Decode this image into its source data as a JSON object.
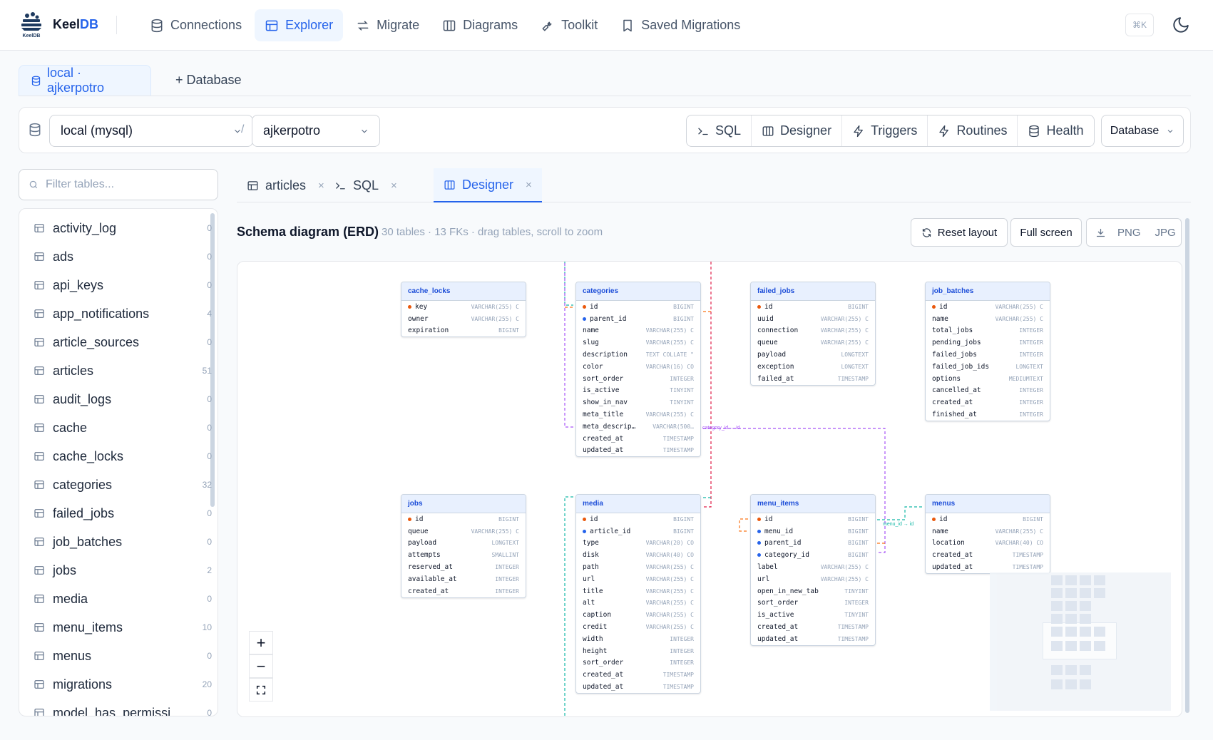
{
  "app": {
    "brand_prefix": "Keel",
    "brand_suffix": "DB",
    "logo_text": "KeelDB",
    "shortcut": "⌘K"
  },
  "nav": [
    {
      "label": "Connections",
      "icon": "database-icon"
    },
    {
      "label": "Explorer",
      "icon": "table-icon",
      "active": true
    },
    {
      "label": "Migrate",
      "icon": "arrows-icon"
    },
    {
      "label": "Diagrams",
      "icon": "columns-icon"
    },
    {
      "label": "Toolkit",
      "icon": "wrench-icon"
    },
    {
      "label": "Saved Migrations",
      "icon": "bookmark-icon"
    }
  ],
  "connection_tabs": {
    "active": "local · ajkerpotro",
    "add": "+ Database"
  },
  "toolbar": {
    "connection": "local (mysql)",
    "separator": "/",
    "schema": "ajkerpotro",
    "buttons": [
      "SQL",
      "Designer",
      "Triggers",
      "Routines",
      "Health"
    ],
    "database_menu": "Database"
  },
  "sidebar": {
    "filter_placeholder": "Filter tables...",
    "tables": [
      {
        "name": "activity_log",
        "count": "0"
      },
      {
        "name": "ads",
        "count": "0"
      },
      {
        "name": "api_keys",
        "count": "0"
      },
      {
        "name": "app_notifications",
        "count": "4"
      },
      {
        "name": "article_sources",
        "count": "0"
      },
      {
        "name": "articles",
        "count": "51"
      },
      {
        "name": "audit_logs",
        "count": "0"
      },
      {
        "name": "cache",
        "count": "0"
      },
      {
        "name": "cache_locks",
        "count": "0"
      },
      {
        "name": "categories",
        "count": "32"
      },
      {
        "name": "failed_jobs",
        "count": "0"
      },
      {
        "name": "job_batches",
        "count": "0"
      },
      {
        "name": "jobs",
        "count": "2"
      },
      {
        "name": "media",
        "count": "0"
      },
      {
        "name": "menu_items",
        "count": "10"
      },
      {
        "name": "menus",
        "count": "0"
      },
      {
        "name": "migrations",
        "count": "20"
      },
      {
        "name": "model_has_permissi",
        "count": "0"
      }
    ]
  },
  "editor_tabs": [
    {
      "label": "articles",
      "close": "×"
    },
    {
      "label": "SQL",
      "close": "×"
    },
    {
      "label": "Designer",
      "close": "×",
      "active": true
    }
  ],
  "erd": {
    "title": "Schema diagram (ERD)",
    "subtitle": "30 tables · 13 FKs · drag tables, scroll to zoom",
    "reset_layout": "Reset layout",
    "full_screen": "Full screen",
    "png": "PNG",
    "jpg": "JPG",
    "zoom_in": "+",
    "zoom_out": "−",
    "link_labels": [
      "category_id → id",
      "menu_id → id"
    ],
    "colors": {
      "pk": "#ea580c",
      "fk": "#2563eb",
      "accent": "#2563eb"
    },
    "tables": [
      {
        "name": "cache_locks",
        "columns": [
          {
            "name": "key",
            "type": "VARCHAR(255) C",
            "kind": "pk"
          },
          {
            "name": "owner",
            "type": "VARCHAR(255) C"
          },
          {
            "name": "expiration",
            "type": "BIGINT"
          }
        ]
      },
      {
        "name": "categories",
        "columns": [
          {
            "name": "id",
            "type": "BIGINT",
            "kind": "pk"
          },
          {
            "name": "parent_id",
            "type": "BIGINT",
            "kind": "fk"
          },
          {
            "name": "name",
            "type": "VARCHAR(255) C"
          },
          {
            "name": "slug",
            "type": "VARCHAR(255) C"
          },
          {
            "name": "description",
            "type": "TEXT COLLATE \""
          },
          {
            "name": "color",
            "type": "VARCHAR(16) CO"
          },
          {
            "name": "sort_order",
            "type": "INTEGER"
          },
          {
            "name": "is_active",
            "type": "TINYINT"
          },
          {
            "name": "show_in_nav",
            "type": "TINYINT"
          },
          {
            "name": "meta_title",
            "type": "VARCHAR(255) C"
          },
          {
            "name": "meta_descrip…",
            "type": "VARCHAR(500…"
          },
          {
            "name": "created_at",
            "type": "TIMESTAMP"
          },
          {
            "name": "updated_at",
            "type": "TIMESTAMP"
          }
        ]
      },
      {
        "name": "failed_jobs",
        "columns": [
          {
            "name": "id",
            "type": "BIGINT",
            "kind": "pk"
          },
          {
            "name": "uuid",
            "type": "VARCHAR(255) C"
          },
          {
            "name": "connection",
            "type": "VARCHAR(255) C"
          },
          {
            "name": "queue",
            "type": "VARCHAR(255) C"
          },
          {
            "name": "payload",
            "type": "LONGTEXT"
          },
          {
            "name": "exception",
            "type": "LONGTEXT"
          },
          {
            "name": "failed_at",
            "type": "TIMESTAMP"
          }
        ]
      },
      {
        "name": "job_batches",
        "columns": [
          {
            "name": "id",
            "type": "VARCHAR(255) C",
            "kind": "pk"
          },
          {
            "name": "name",
            "type": "VARCHAR(255) C"
          },
          {
            "name": "total_jobs",
            "type": "INTEGER"
          },
          {
            "name": "pending_jobs",
            "type": "INTEGER"
          },
          {
            "name": "failed_jobs",
            "type": "INTEGER"
          },
          {
            "name": "failed_job_ids",
            "type": "LONGTEXT"
          },
          {
            "name": "options",
            "type": "MEDIUMTEXT"
          },
          {
            "name": "cancelled_at",
            "type": "INTEGER"
          },
          {
            "name": "created_at",
            "type": "INTEGER"
          },
          {
            "name": "finished_at",
            "type": "INTEGER"
          }
        ]
      },
      {
        "name": "jobs",
        "columns": [
          {
            "name": "id",
            "type": "BIGINT",
            "kind": "pk"
          },
          {
            "name": "queue",
            "type": "VARCHAR(255) C"
          },
          {
            "name": "payload",
            "type": "LONGTEXT"
          },
          {
            "name": "attempts",
            "type": "SMALLINT"
          },
          {
            "name": "reserved_at",
            "type": "INTEGER"
          },
          {
            "name": "available_at",
            "type": "INTEGER"
          },
          {
            "name": "created_at",
            "type": "INTEGER"
          }
        ]
      },
      {
        "name": "media",
        "columns": [
          {
            "name": "id",
            "type": "BIGINT",
            "kind": "pk"
          },
          {
            "name": "article_id",
            "type": "BIGINT",
            "kind": "fk"
          },
          {
            "name": "type",
            "type": "VARCHAR(20) CO"
          },
          {
            "name": "disk",
            "type": "VARCHAR(40) CO"
          },
          {
            "name": "path",
            "type": "VARCHAR(255) C"
          },
          {
            "name": "url",
            "type": "VARCHAR(255) C"
          },
          {
            "name": "title",
            "type": "VARCHAR(255) C"
          },
          {
            "name": "alt",
            "type": "VARCHAR(255) C"
          },
          {
            "name": "caption",
            "type": "VARCHAR(255) C"
          },
          {
            "name": "credit",
            "type": "VARCHAR(255) C"
          },
          {
            "name": "width",
            "type": "INTEGER"
          },
          {
            "name": "height",
            "type": "INTEGER"
          },
          {
            "name": "sort_order",
            "type": "INTEGER"
          },
          {
            "name": "created_at",
            "type": "TIMESTAMP"
          },
          {
            "name": "updated_at",
            "type": "TIMESTAMP"
          }
        ]
      },
      {
        "name": "menu_items",
        "columns": [
          {
            "name": "id",
            "type": "BIGINT",
            "kind": "pk"
          },
          {
            "name": "menu_id",
            "type": "BIGINT",
            "kind": "fk"
          },
          {
            "name": "parent_id",
            "type": "BIGINT",
            "kind": "fk"
          },
          {
            "name": "category_id",
            "type": "BIGINT",
            "kind": "fk"
          },
          {
            "name": "label",
            "type": "VARCHAR(255) C"
          },
          {
            "name": "url",
            "type": "VARCHAR(255) C"
          },
          {
            "name": "open_in_new_tab",
            "type": "TINYINT"
          },
          {
            "name": "sort_order",
            "type": "INTEGER"
          },
          {
            "name": "is_active",
            "type": "TINYINT"
          },
          {
            "name": "created_at",
            "type": "TIMESTAMP"
          },
          {
            "name": "updated_at",
            "type": "TIMESTAMP"
          }
        ]
      },
      {
        "name": "menus",
        "columns": [
          {
            "name": "id",
            "type": "BIGINT",
            "kind": "pk"
          },
          {
            "name": "name",
            "type": "VARCHAR(255) C"
          },
          {
            "name": "location",
            "type": "VARCHAR(40) CO"
          },
          {
            "name": "created_at",
            "type": "TIMESTAMP"
          },
          {
            "name": "updated_at",
            "type": "TIMESTAMP"
          }
        ]
      }
    ]
  }
}
